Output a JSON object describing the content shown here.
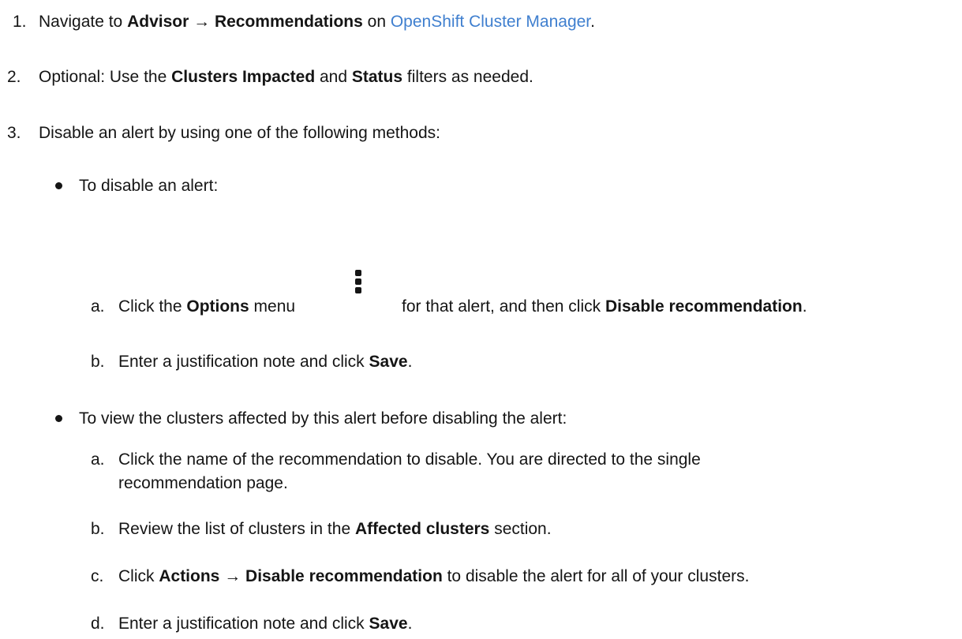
{
  "steps": [
    {
      "number": "1.",
      "pre": "Navigate to ",
      "b1": "Advisor",
      "arrow": " → ",
      "b2": "Recommendations",
      "mid": " on ",
      "link": "OpenShift Cluster Manager",
      "post": "."
    },
    {
      "number": "2.",
      "pre": "Optional: Use the ",
      "b1": "Clusters Impacted",
      "mid": " and ",
      "b2": "Status",
      "post": " filters as needed."
    },
    {
      "number": "3.",
      "text": "Disable an alert by using one of the following methods:"
    }
  ],
  "method_one": {
    "bullet_text": "To disable an alert:",
    "a": {
      "letter": "a.",
      "pre": "Click the ",
      "b1": "Options",
      "mid": " menu",
      "icon": "kebab-icon",
      "mid2": " for that alert, and then click ",
      "b2": "Disable recommendation",
      "post": "."
    },
    "b": {
      "letter": "b.",
      "pre": "Enter a justification note and click ",
      "b1": "Save",
      "post": "."
    }
  },
  "method_two": {
    "bullet_text": "To view the clusters affected by this alert before disabling the alert:",
    "a": {
      "letter": "a.",
      "line1": "Click the name of the recommendation to disable. You are directed to the single",
      "line2": "recommendation page."
    },
    "b": {
      "letter": "b.",
      "pre": "Review the list of clusters in the ",
      "b1": "Affected clusters",
      "post": " section."
    },
    "c": {
      "letter": "c.",
      "pre": "Click ",
      "b1": "Actions",
      "arrow": " → ",
      "b2": "Disable recommendation",
      "post": " to disable the alert for all of your clusters."
    },
    "d": {
      "letter": "d.",
      "pre": "Enter a justification note and click ",
      "b1": "Save",
      "post": "."
    }
  }
}
